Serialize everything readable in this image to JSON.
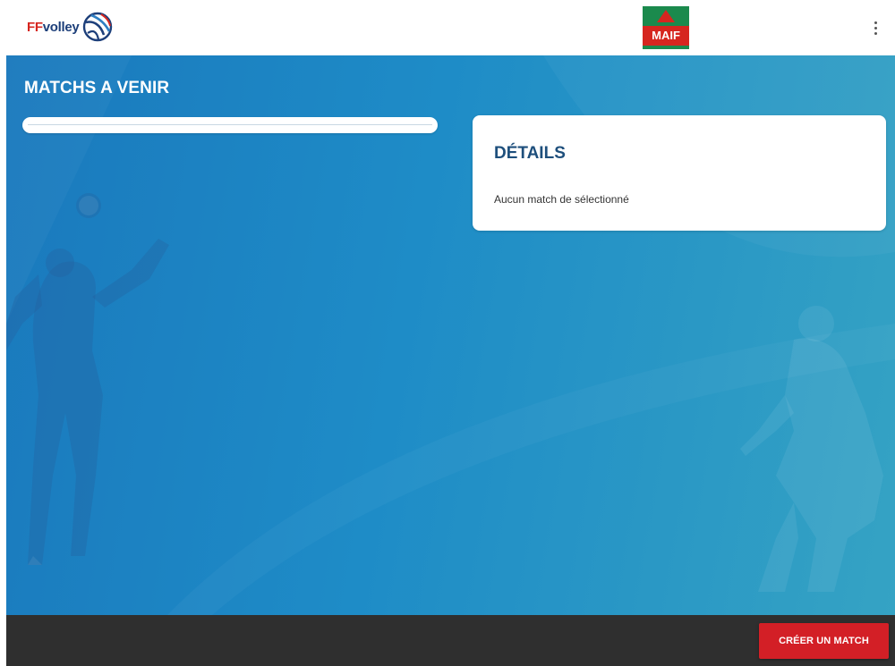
{
  "header": {
    "ff_prefix": "FF",
    "ff_suffix": "volley",
    "sponsor": "MAIF",
    "menu_icon": "more-vertical-icon",
    "ball_icon": "volleyball-icon"
  },
  "main": {
    "section_title": "MATCHS A VENIR",
    "details": {
      "title": "DÉTAILS",
      "empty_message": "Aucun match de sélectionné"
    }
  },
  "footer": {
    "create_button_label": "CRÉER UN MATCH"
  },
  "colors": {
    "brand_red": "#d31f26",
    "brand_blue": "#1d3f7a",
    "background_blue": "#1e8cc7",
    "footer_dark": "#2f2f2f",
    "maif_green": "#1b8a4d"
  }
}
